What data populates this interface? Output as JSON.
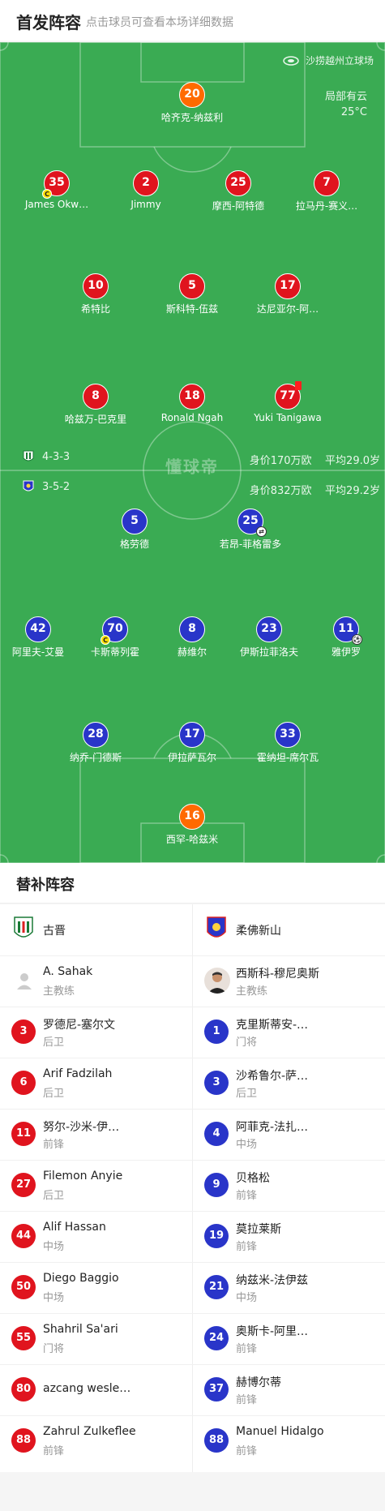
{
  "header": {
    "title": "首发阵容",
    "subtitle": "点击球员可查看本场详细数据"
  },
  "pitch": {
    "venue": "沙捞越州立球场",
    "weather": "局部有云",
    "temperature": "25°C",
    "watermark": "懂球帝",
    "home_formation": "4-3-3",
    "away_formation": "3-5-2",
    "home_value": "身价170万欧",
    "home_avg_age": "平均29.0岁",
    "away_value": "身价832万欧",
    "away_avg_age": "平均29.2岁",
    "colors": {
      "grass": "#3aab53",
      "home": "#e0141e",
      "gk": "#ff6a00",
      "away": "#2935c9"
    }
  },
  "home_lineup": [
    {
      "num": "20",
      "name": "哈齐克-纳兹利",
      "kit": "orange"
    },
    {
      "num": "35",
      "name": "James Okw…",
      "kit": "red",
      "captain": true
    },
    {
      "num": "2",
      "name": "Jimmy",
      "kit": "red"
    },
    {
      "num": "25",
      "name": "摩西-阿特德",
      "kit": "red"
    },
    {
      "num": "7",
      "name": "拉马丹-赛义…",
      "kit": "red"
    },
    {
      "num": "10",
      "name": "希特比",
      "kit": "red"
    },
    {
      "num": "5",
      "name": "斯科特-伍兹",
      "kit": "red"
    },
    {
      "num": "17",
      "name": "达尼亚尔-阿…",
      "kit": "red"
    },
    {
      "num": "8",
      "name": "哈兹万-巴克里",
      "kit": "red"
    },
    {
      "num": "18",
      "name": "Ronald Ngah",
      "kit": "red"
    },
    {
      "num": "77",
      "name": "Yuki Tanigawa",
      "kit": "red",
      "red_card": true
    }
  ],
  "away_lineup": [
    {
      "num": "5",
      "name": "格劳德",
      "kit": "blue"
    },
    {
      "num": "25",
      "name": "若昂-菲格雷多",
      "kit": "blue",
      "sub_icon": true
    },
    {
      "num": "42",
      "name": "阿里夫-艾曼",
      "kit": "blue"
    },
    {
      "num": "70",
      "name": "卡斯蒂列霍",
      "kit": "blue",
      "captain": true
    },
    {
      "num": "8",
      "name": "赫维尔",
      "kit": "blue"
    },
    {
      "num": "23",
      "name": "伊斯拉菲洛夫",
      "kit": "blue"
    },
    {
      "num": "11",
      "name": "雅伊罗",
      "kit": "blue",
      "goal": true
    },
    {
      "num": "28",
      "name": "纳乔-门德斯",
      "kit": "blue"
    },
    {
      "num": "17",
      "name": "伊拉萨瓦尔",
      "kit": "blue"
    },
    {
      "num": "33",
      "name": "霍纳坦-席尔瓦",
      "kit": "blue"
    },
    {
      "num": "16",
      "name": "西罕-哈兹米",
      "kit": "orange"
    }
  ],
  "captain_mark": "C",
  "subs": {
    "title": "替补阵容",
    "home_team": "古晋",
    "away_team": "柔佛新山",
    "home_coach": {
      "name": "A. Sahak",
      "role": "主教练"
    },
    "away_coach": {
      "name": "西斯科-穆尼奥斯",
      "role": "主教练"
    },
    "home": [
      {
        "num": "3",
        "name": "罗德尼-塞尔文",
        "pos": "后卫"
      },
      {
        "num": "6",
        "name": "Arif Fadzilah",
        "pos": "后卫"
      },
      {
        "num": "11",
        "name": "努尔-沙米-伊…",
        "pos": "前锋"
      },
      {
        "num": "27",
        "name": "Filemon Anyie",
        "pos": "后卫"
      },
      {
        "num": "44",
        "name": "Alif Hassan",
        "pos": "中场"
      },
      {
        "num": "50",
        "name": "Diego Baggio",
        "pos": "中场"
      },
      {
        "num": "55",
        "name": "Shahril Sa'ari",
        "pos": "门将"
      },
      {
        "num": "80",
        "name": "azcang wesle…",
        "pos": ""
      },
      {
        "num": "88",
        "name": "Zahrul Zulkeflee",
        "pos": "前锋"
      }
    ],
    "away": [
      {
        "num": "1",
        "name": "克里斯蒂安-…",
        "pos": "门将"
      },
      {
        "num": "3",
        "name": "沙希鲁尔-萨…",
        "pos": "后卫"
      },
      {
        "num": "4",
        "name": "阿菲克-法扎…",
        "pos": "中场"
      },
      {
        "num": "9",
        "name": "贝格松",
        "pos": "前锋"
      },
      {
        "num": "19",
        "name": "莫拉莱斯",
        "pos": "前锋"
      },
      {
        "num": "21",
        "name": "纳兹米-法伊兹",
        "pos": "中场"
      },
      {
        "num": "24",
        "name": "奥斯卡-阿里…",
        "pos": "前锋"
      },
      {
        "num": "37",
        "name": "赫博尔蒂",
        "pos": "前锋"
      },
      {
        "num": "88",
        "name": "Manuel Hidalgo",
        "pos": "前锋"
      }
    ]
  }
}
